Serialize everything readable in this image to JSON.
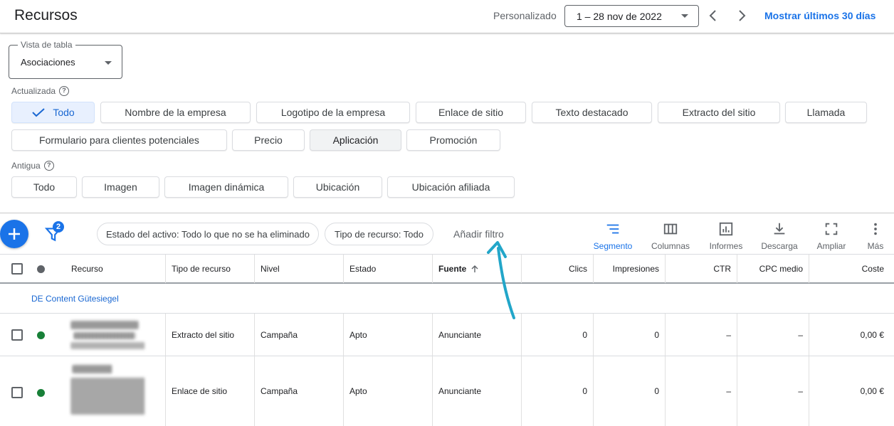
{
  "header": {
    "title": "Recursos",
    "date_mode_label": "Personalizado",
    "date_range": "1 – 28 nov de 2022",
    "show_last_30": "Mostrar últimos 30 días"
  },
  "table_view": {
    "legend": "Vista de tabla",
    "value": "Asociaciones"
  },
  "updated": {
    "label": "Actualizada",
    "chips": [
      "Todo",
      "Nombre de la empresa",
      "Logotipo de la empresa",
      "Enlace de sitio",
      "Texto destacado",
      "Extracto del sitio",
      "Llamada",
      "Formulario para clientes potenciales",
      "Precio",
      "Aplicación",
      "Promoción"
    ]
  },
  "legacy": {
    "label": "Antigua",
    "chips": [
      "Todo",
      "Imagen",
      "Imagen dinámica",
      "Ubicación",
      "Ubicación afiliada"
    ]
  },
  "toolbar": {
    "filter_count": "2",
    "filters": [
      "Estado del activo: Todo lo que no se ha eliminado",
      "Tipo de recurso: Todo"
    ],
    "add_filter": "Añadir filtro",
    "tools": [
      "Segmento",
      "Columnas",
      "Informes",
      "Descarga",
      "Ampliar",
      "Más"
    ]
  },
  "table": {
    "columns": [
      "Recurso",
      "Tipo de recurso",
      "Nivel",
      "Estado",
      "Fuente",
      "Clics",
      "Impresiones",
      "CTR",
      "CPC medio",
      "Coste"
    ],
    "group": "DE Content Gütesiegel",
    "rows": [
      {
        "type": "Extracto del sitio",
        "level": "Campaña",
        "status": "Apto",
        "source": "Anunciante",
        "clicks": "0",
        "impressions": "0",
        "ctr": "–",
        "cpc": "–",
        "cost": "0,00 €"
      },
      {
        "type": "Enlace de sitio",
        "level": "Campaña",
        "status": "Apto",
        "source": "Anunciante",
        "clicks": "0",
        "impressions": "0",
        "ctr": "–",
        "cpc": "–",
        "cost": "0,00 €"
      }
    ]
  },
  "colors": {
    "accent": "#1a73e8",
    "status_green": "#188038",
    "annotation": "#22a6c9"
  }
}
